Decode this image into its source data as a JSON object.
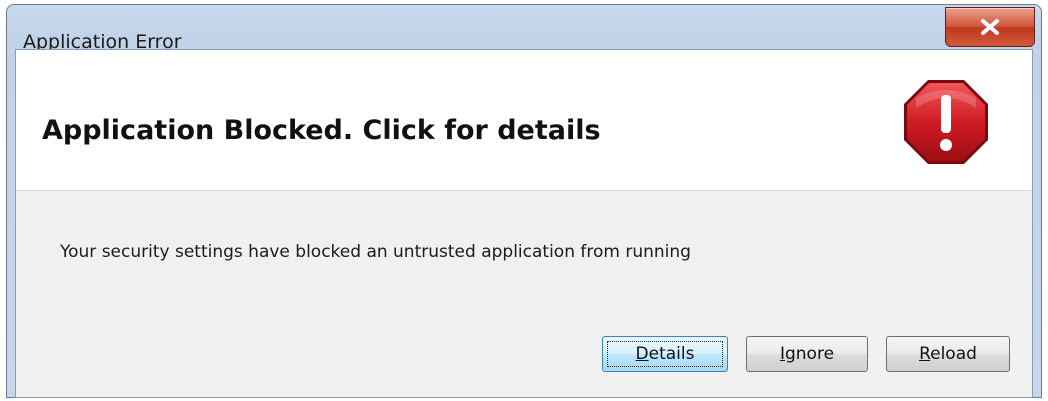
{
  "window": {
    "title": "Application Error",
    "close_label": "X"
  },
  "header": {
    "title": "Application Blocked. Click for details",
    "icon": "error-stop-icon"
  },
  "message": "Your security settings have blocked an untrusted application from running",
  "buttons": [
    {
      "label": "Details",
      "mnemonic": "D",
      "rest": "etails",
      "focused": true
    },
    {
      "label": "Ignore",
      "mnemonic": "I",
      "rest": "gnore",
      "focused": false
    },
    {
      "label": "Reload",
      "mnemonic": "R",
      "rest": "eload",
      "focused": false
    }
  ],
  "colors": {
    "titlebar": "#bfd2e8",
    "close": "#c0381c",
    "icon_red": "#c8171e",
    "focus_button": "#3c7fb1"
  }
}
